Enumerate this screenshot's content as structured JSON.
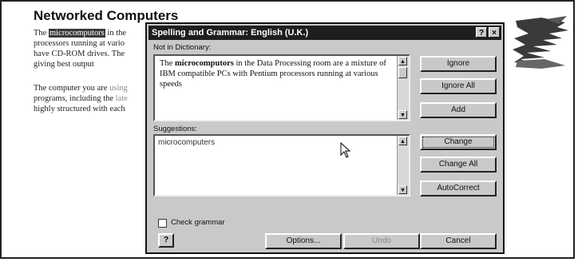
{
  "document": {
    "title": "Networked Computers",
    "lines": [
      {
        "pre": "The ",
        "hl": "microcomputors",
        "post": " in the"
      },
      {
        "text": "processors running at vario"
      },
      {
        "text": "have CD-ROM drives. The"
      },
      {
        "text": "giving best output"
      },
      {
        "text": ""
      },
      {
        "pre": "The computer you are ",
        "grey": "using"
      },
      {
        "pre": "programs, including the ",
        "grey": "late"
      },
      {
        "text": "highly structured with each"
      }
    ]
  },
  "dialog": {
    "title": "Spelling and Grammar: English (U.K.)",
    "title_buttons": {
      "help": "?",
      "close": "×"
    },
    "not_in_dictionary_label": "Not in Dictionary:",
    "sentence": {
      "pre": "The ",
      "bold_word": "microcomputors",
      "post": " in the Data Processing room are a mixture of IBM compatible PCs with Pentium processors running at various speeds"
    },
    "suggestions_label": "Suggestions:",
    "suggestions": [
      "microcomputers"
    ],
    "buttons": {
      "ignore": "Ignore",
      "ignore_all": "Ignore All",
      "add": "Add",
      "change": "Change",
      "change_all": "Change All",
      "autocorrect": "AutoCorrect",
      "options": "Options...",
      "undo": "Undo",
      "cancel": "Cancel"
    },
    "check_grammar_label": "Check grammar",
    "check_grammar_checked": false,
    "help_icon_glyph": "?"
  }
}
